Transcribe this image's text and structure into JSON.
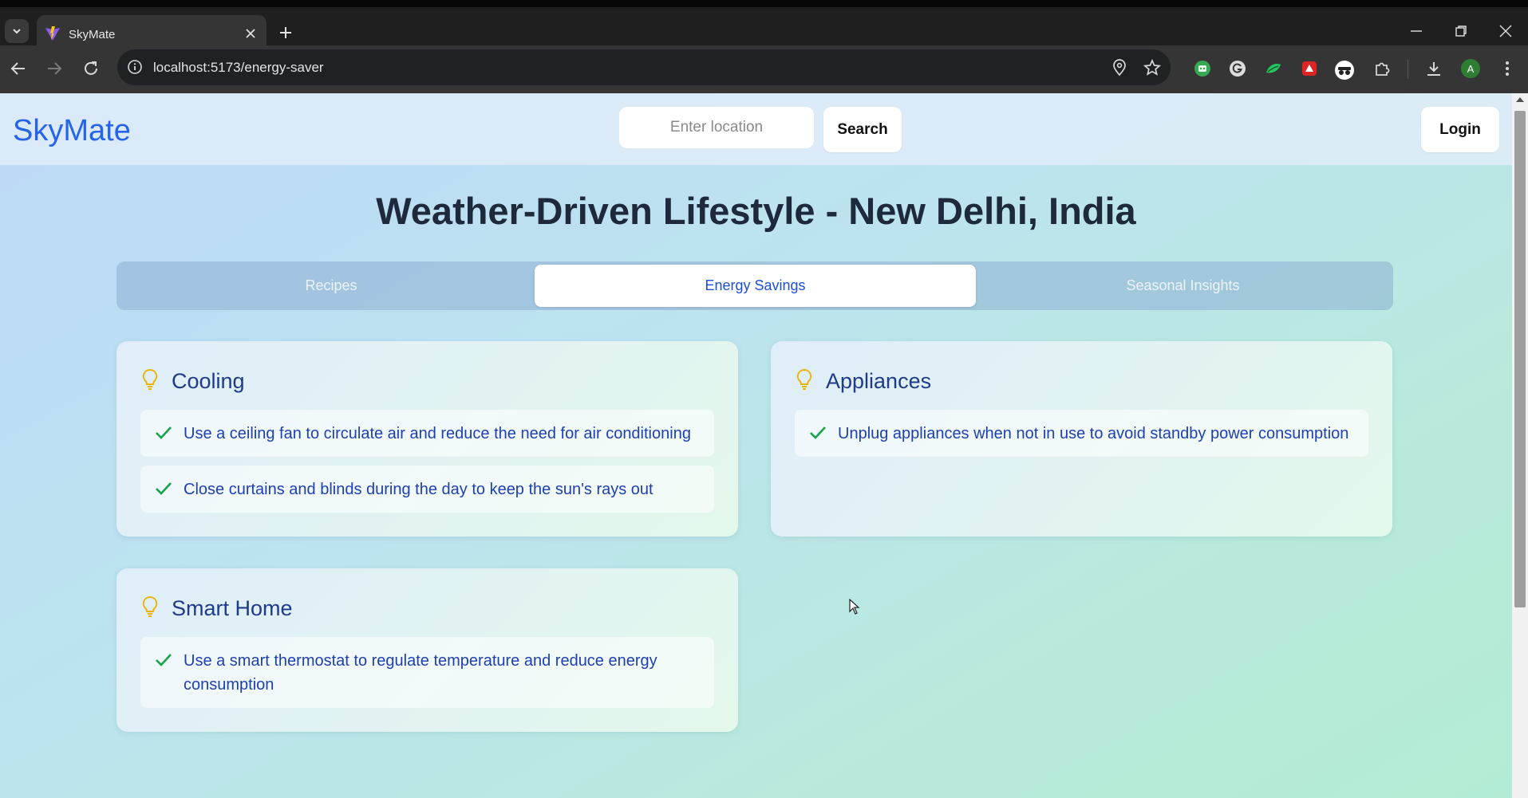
{
  "browser": {
    "tab_title": "SkyMate",
    "url": "localhost:5173/energy-saver",
    "profile_initial": "A"
  },
  "header": {
    "logo": "SkyMate",
    "search_placeholder": "Enter location",
    "search_label": "Search",
    "login_label": "Login"
  },
  "main": {
    "title": "Weather-Driven Lifestyle - New Delhi, India",
    "tabs": [
      "Recipes",
      "Energy Savings",
      "Seasonal Insights"
    ],
    "active_tab": "Energy Savings",
    "cards": [
      {
        "title": "Cooling",
        "tips": [
          "Use a ceiling fan to circulate air and reduce the need for air conditioning",
          "Close curtains and blinds during the day to keep the sun's rays out"
        ]
      },
      {
        "title": "Appliances",
        "tips": [
          "Unplug appliances when not in use to avoid standby power consumption"
        ]
      },
      {
        "title": "Smart Home",
        "tips": [
          "Use a smart thermostat to regulate temperature and reduce energy consumption"
        ]
      }
    ]
  },
  "colors": {
    "logo": "#2563eb",
    "title": "#1e293b",
    "card_heading": "#1e3a8a",
    "tip_text": "#1e40af",
    "check": "#16a34a",
    "bulb": "#eab308"
  },
  "icons": {
    "card": "lightbulb-icon",
    "tip": "check-icon"
  }
}
